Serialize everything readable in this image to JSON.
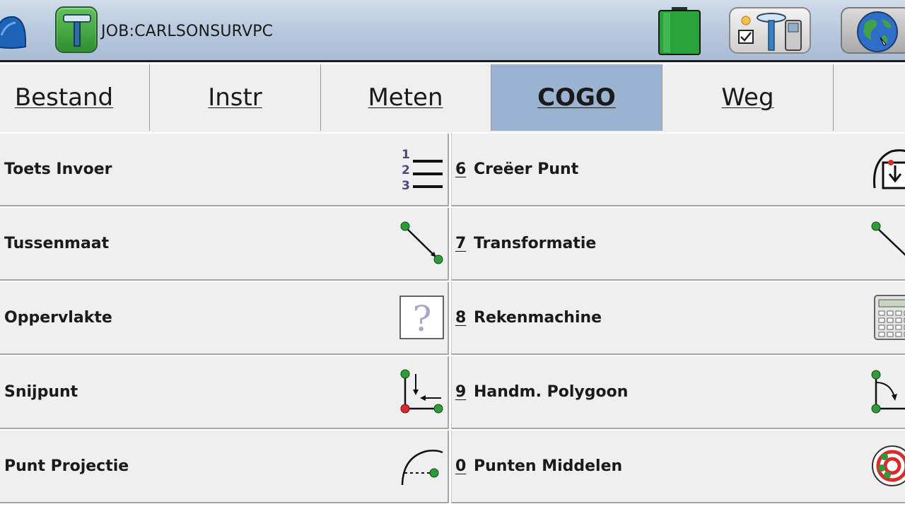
{
  "header": {
    "job_title": "JOB:CARLSONSURVPC",
    "icons": [
      "hardhat-icon",
      "job-icon",
      "battery-icon",
      "gps-rover-icon",
      "globe-icon"
    ]
  },
  "tabs": [
    {
      "label": "Bestand",
      "active": false
    },
    {
      "label": "Instr",
      "active": false
    },
    {
      "label": "Meten",
      "active": false
    },
    {
      "label": "COGO",
      "active": true
    },
    {
      "label": "Weg",
      "active": false
    }
  ],
  "menu": {
    "left": [
      {
        "label": "Toets Invoer",
        "icon": "numbered-list-icon"
      },
      {
        "label": "Tussenmaat",
        "icon": "inverse-line-icon"
      },
      {
        "label": "Oppervlakte",
        "icon": "question-icon"
      },
      {
        "label": "Snijpunt",
        "icon": "intersection-icon"
      },
      {
        "label": "Punt Projectie",
        "icon": "point-projection-icon"
      }
    ],
    "right": [
      {
        "key": "6",
        "label": "Creëer Punt",
        "icon": "create-point-icon"
      },
      {
        "key": "7",
        "label": "Transformatie",
        "icon": "transformation-icon"
      },
      {
        "key": "8",
        "label": "Rekenmachine",
        "icon": "calculator-icon"
      },
      {
        "key": "9",
        "label": "Handm. Polygoon",
        "icon": "polygon-icon"
      },
      {
        "key": "0",
        "label": "Punten Middelen",
        "icon": "average-points-icon"
      }
    ]
  },
  "colors": {
    "topbar": "#b7c8dd",
    "active_tab": "#9ab3d1",
    "cell_bg": "#efefef",
    "point_green": "#2e9a3a",
    "point_red": "#d92b2b"
  }
}
